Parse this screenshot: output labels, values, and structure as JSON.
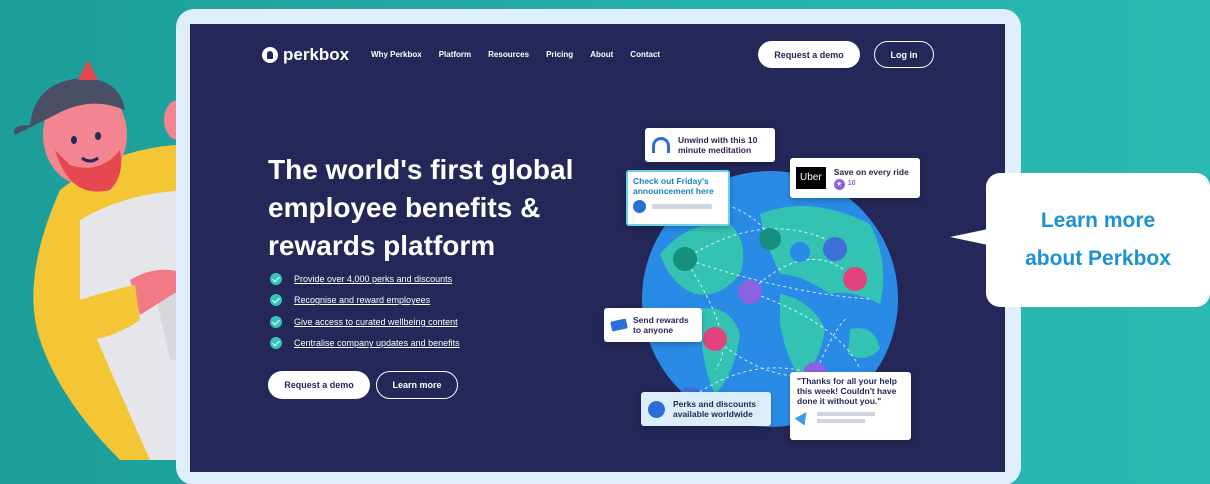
{
  "brand": {
    "name": "perkbox"
  },
  "nav": {
    "items": [
      {
        "label": "Why Perkbox"
      },
      {
        "label": "Platform"
      },
      {
        "label": "Resources"
      },
      {
        "label": "Pricing"
      },
      {
        "label": "About"
      },
      {
        "label": "Contact"
      }
    ],
    "request_demo": "Request a demo",
    "login": "Log in"
  },
  "hero": {
    "title": "The world's first global employee benefits & rewards platform",
    "features": [
      "Provide over 4,000 perks and discounts",
      "Recognise and reward employees",
      "Give access to curated wellbeing content",
      "Centralise company updates and benefits"
    ],
    "request_demo": "Request a demo",
    "learn_more": "Learn more"
  },
  "cards": {
    "meditation": "Unwind with this 10\nminute meditation",
    "announcement": "Check out Friday's\nannouncement here",
    "uber_logo": "Uber",
    "uber_title": "Save on every ride",
    "uber_points": "10",
    "rewards": "Send rewards\nto anyone",
    "perks": "Perks and discounts\navailable worldwide",
    "quote": "\"Thanks for all your help\nthis week! Couldn't have\ndone it without you.\""
  },
  "bubble": {
    "text": "Learn more\nabout Perkbox"
  },
  "colors": {
    "background": "#26b0ac",
    "screen": "#242758",
    "accent": "#33c6b8",
    "bubble_text": "#1c92d2"
  },
  "icons": [
    "headphones-icon",
    "play-icon",
    "star-icon",
    "card-icon",
    "globe-icon",
    "party-icon",
    "check-icon"
  ]
}
